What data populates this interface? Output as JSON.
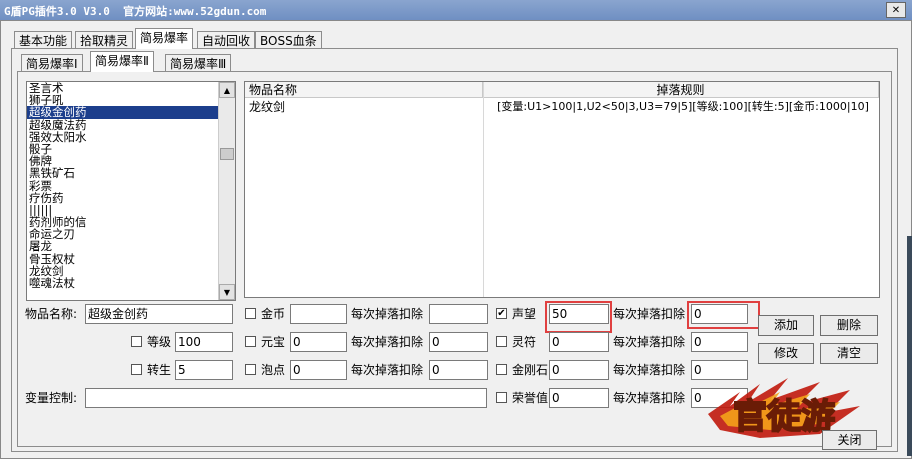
{
  "title": "G盾PG插件3.0 V3.0  官方网站:www.52gdun.com",
  "main_tabs": [
    "基本功能",
    "拾取精灵",
    "简易爆率",
    "自动回收",
    "BOSS血条"
  ],
  "sub_tabs": [
    "简易爆率Ⅰ",
    "简易爆率Ⅱ",
    "简易爆率Ⅲ"
  ],
  "item_list": [
    "圣言术",
    "狮子吼",
    "超级金创药",
    "超级魔法药",
    "强效太阳水",
    "骰子",
    "佛牌",
    "黑铁矿石",
    "彩票",
    "疗伤药",
    "||||||",
    "药剂师的信",
    "命运之刃",
    "屠龙",
    "骨玉权杖",
    "龙纹剑",
    "噬魂法杖"
  ],
  "grid": {
    "headers": [
      "物品名称",
      "掉落规则"
    ],
    "rows": [
      {
        "name": "龙纹剑",
        "rule": "[变量:U1>100|1,U2<50|3,U3=79|5][等级:100][转生:5][金币:1000|10]"
      }
    ]
  },
  "form": {
    "item_name_label": "物品名称:",
    "item_name_value": "超级金创药",
    "level_label": "等级",
    "level_value": "100",
    "reborn_label": "转生",
    "reborn_value": "5",
    "var_label": "变量控制:",
    "var_value": "",
    "gold_label": "金币",
    "gold_value": "",
    "yuanbao_label": "元宝",
    "yuanbao_value": "0",
    "paodian_label": "泡点",
    "paodian_value": "0",
    "deduct_label": "每次掉落扣除",
    "deduct_gold": "",
    "deduct_yuanbao": "0",
    "deduct_paodian": "0",
    "prestige_label": "声望",
    "prestige_value": "50",
    "lingfu_label": "灵符",
    "lingfu_value": "0",
    "diamond_label": "金刚石",
    "diamond_value": "0",
    "honor_label": "荣誉值",
    "honor_value": "0",
    "deduct_prestige": "0",
    "deduct_lingfu": "0",
    "deduct_diamond": "0",
    "deduct_honor": "0",
    "prestige_checked": "✔"
  },
  "buttons": {
    "add": "添加",
    "delete": "删除",
    "modify": "修改",
    "clear": "清空",
    "close": "关闭"
  },
  "logo_text": "官徒游"
}
